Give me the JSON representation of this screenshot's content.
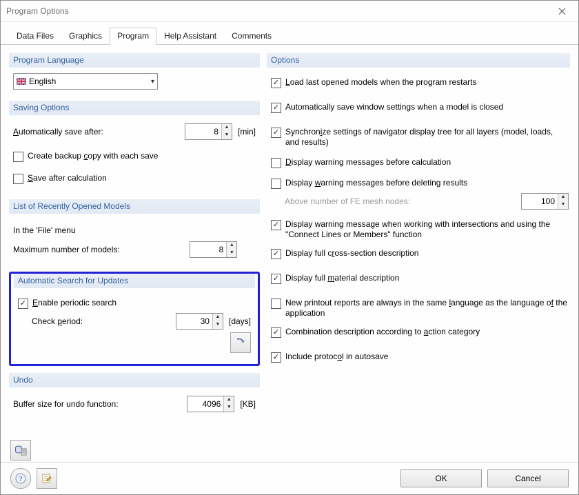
{
  "window": {
    "title": "Program Options"
  },
  "tabs": [
    "Data Files",
    "Graphics",
    "Program",
    "Help Assistant",
    "Comments"
  ],
  "active_tab": 2,
  "left": {
    "lang": {
      "header": "Program Language",
      "value": "English"
    },
    "saving": {
      "header": "Saving Options",
      "auto_save_label": "Automatically save after:",
      "auto_save_value": "8",
      "auto_save_unit": "[min]",
      "backup_label": "Create backup copy with each save",
      "backup_checked": false,
      "save_after_calc_label": "Save after calculation",
      "save_after_calc_checked": false
    },
    "recent": {
      "header": "List of Recently Opened Models",
      "file_menu_label": "In the 'File' menu",
      "max_label": "Maximum number of models:",
      "max_value": "8"
    },
    "updates": {
      "header": "Automatic Search for Updates",
      "enable_label": "Enable periodic search",
      "enable_checked": true,
      "period_label": "Check period:",
      "period_value": "30",
      "period_unit": "[days]"
    },
    "undo": {
      "header": "Undo",
      "buffer_label": "Buffer size for undo function:",
      "buffer_value": "4096",
      "buffer_unit": "[KB]"
    }
  },
  "right": {
    "header": "Options",
    "opts": [
      {
        "checked": true,
        "text": "Load last opened models when the program restarts"
      },
      {
        "checked": true,
        "text": "Automatically save window settings when a model is closed"
      },
      {
        "checked": true,
        "text": "Synchronize settings of navigator display tree for all layers (model, loads, and results)"
      },
      {
        "checked": false,
        "text": "Display warning messages before calculation"
      },
      {
        "checked": false,
        "text": "Display warning messages before deleting results"
      }
    ],
    "fe_label": "Above number of FE mesh nodes:",
    "fe_value": "100",
    "opts2": [
      {
        "checked": true,
        "text": "Display warning message when working with intersections and using the \"Connect Lines or Members\" function"
      },
      {
        "checked": true,
        "text": "Display full cross-section description"
      },
      {
        "checked": true,
        "text": "Display full material description"
      },
      {
        "checked": false,
        "text": "New printout reports are always in the same language as the language of the application"
      },
      {
        "checked": true,
        "text": "Combination description according to action category"
      },
      {
        "checked": true,
        "text": "Include protocol in autosave"
      }
    ]
  },
  "footer": {
    "ok": "OK",
    "cancel": "Cancel"
  }
}
